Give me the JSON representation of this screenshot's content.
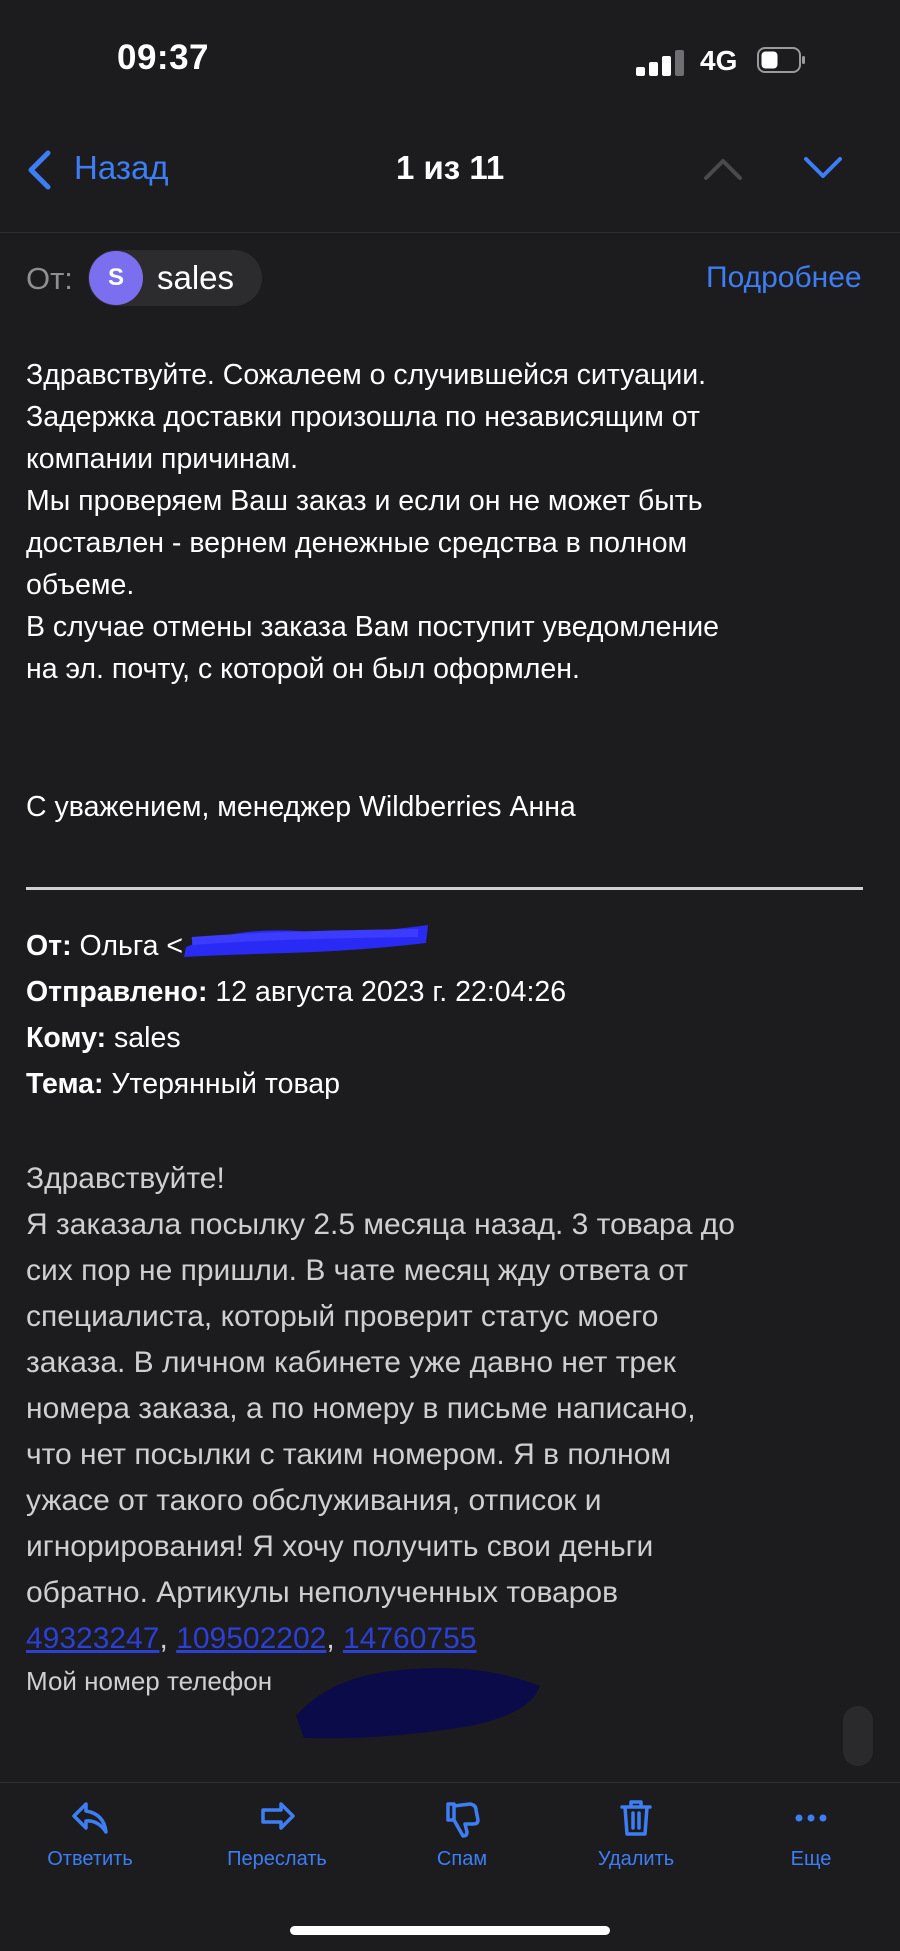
{
  "status_bar": {
    "time": "09:37",
    "network": "4G"
  },
  "nav": {
    "back_label": "Назад",
    "counter": "1 из 11"
  },
  "sender": {
    "from_label": "От:",
    "avatar_letter": "S",
    "name": "sales",
    "details_link": "Подробнее"
  },
  "reply": {
    "lines": [
      "Здравствуйте. Сожалеем о случившейся ситуации.",
      "Задержка доставки произошла по независящим от",
      "компании причинам.",
      "Мы проверяем Ваш заказ и если он не может быть",
      "доставлен - вернем денежные средства в полном",
      "объеме.",
      "В случае отмены заказа Вам поступит уведомление",
      "на эл. почту, с которой он был оформлен."
    ],
    "signature": "С уважением, менеджер Wildberries Анна"
  },
  "original_header": {
    "from_label": "От:",
    "from_value": "Ольга <",
    "sent_label": "Отправлено:",
    "sent_value": "12 августа 2023 г. 22:04:26",
    "to_label": "Кому:",
    "to_value": "sales",
    "subject_label": "Тема:",
    "subject_value": "Утерянный товар"
  },
  "original_body": {
    "lines": [
      "Здравствуйте!",
      "Я заказала посылку 2.5 месяца назад. 3 товара до",
      "сих пор не пришли. В чате месяц жду ответа от",
      "специалиста, который проверит статус моего",
      "заказа. В личном кабинете уже давно нет трек",
      "номера заказа, а по номеру в письме написано,",
      "что нет посылки с таким номером.  Я в полном",
      "ужасе от такого обслуживания, отписок и",
      "игнорирования! Я хочу получить свои деньги",
      "обратно. Артикулы неполученных товаров"
    ],
    "articles": [
      "49323247",
      "109502202",
      "14760755"
    ],
    "article_separator": ", ",
    "phone_line": "Мой номер телефон"
  },
  "toolbar": {
    "reply": "Ответить",
    "forward": "Переслать",
    "spam": "Спам",
    "delete": "Удалить",
    "more": "Еще"
  },
  "colors": {
    "accent": "#3d7ef5",
    "background": "#1c1c1e",
    "avatar": "#7b6ff0",
    "link": "#2c3fd6",
    "redaction": "#2a2bff"
  }
}
